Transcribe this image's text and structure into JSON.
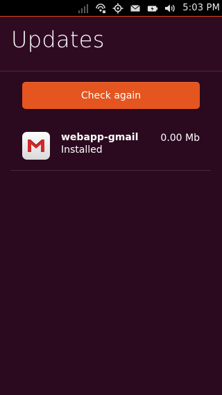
{
  "status_bar": {
    "icons": [
      "signal-icon",
      "wifi-icon",
      "location-icon",
      "mail-icon",
      "battery-icon",
      "volume-icon"
    ],
    "time": "5:03 PM",
    "accent_color": "#dd4814"
  },
  "header": {
    "title": "Updates"
  },
  "main": {
    "check_button_label": "Check again",
    "updates": [
      {
        "name": "webapp-gmail",
        "status": "Installed",
        "size": "0.00 Mb",
        "icon": "gmail-icon"
      }
    ]
  },
  "colors": {
    "background": "#2b0a1f",
    "button": "#e4551f"
  }
}
